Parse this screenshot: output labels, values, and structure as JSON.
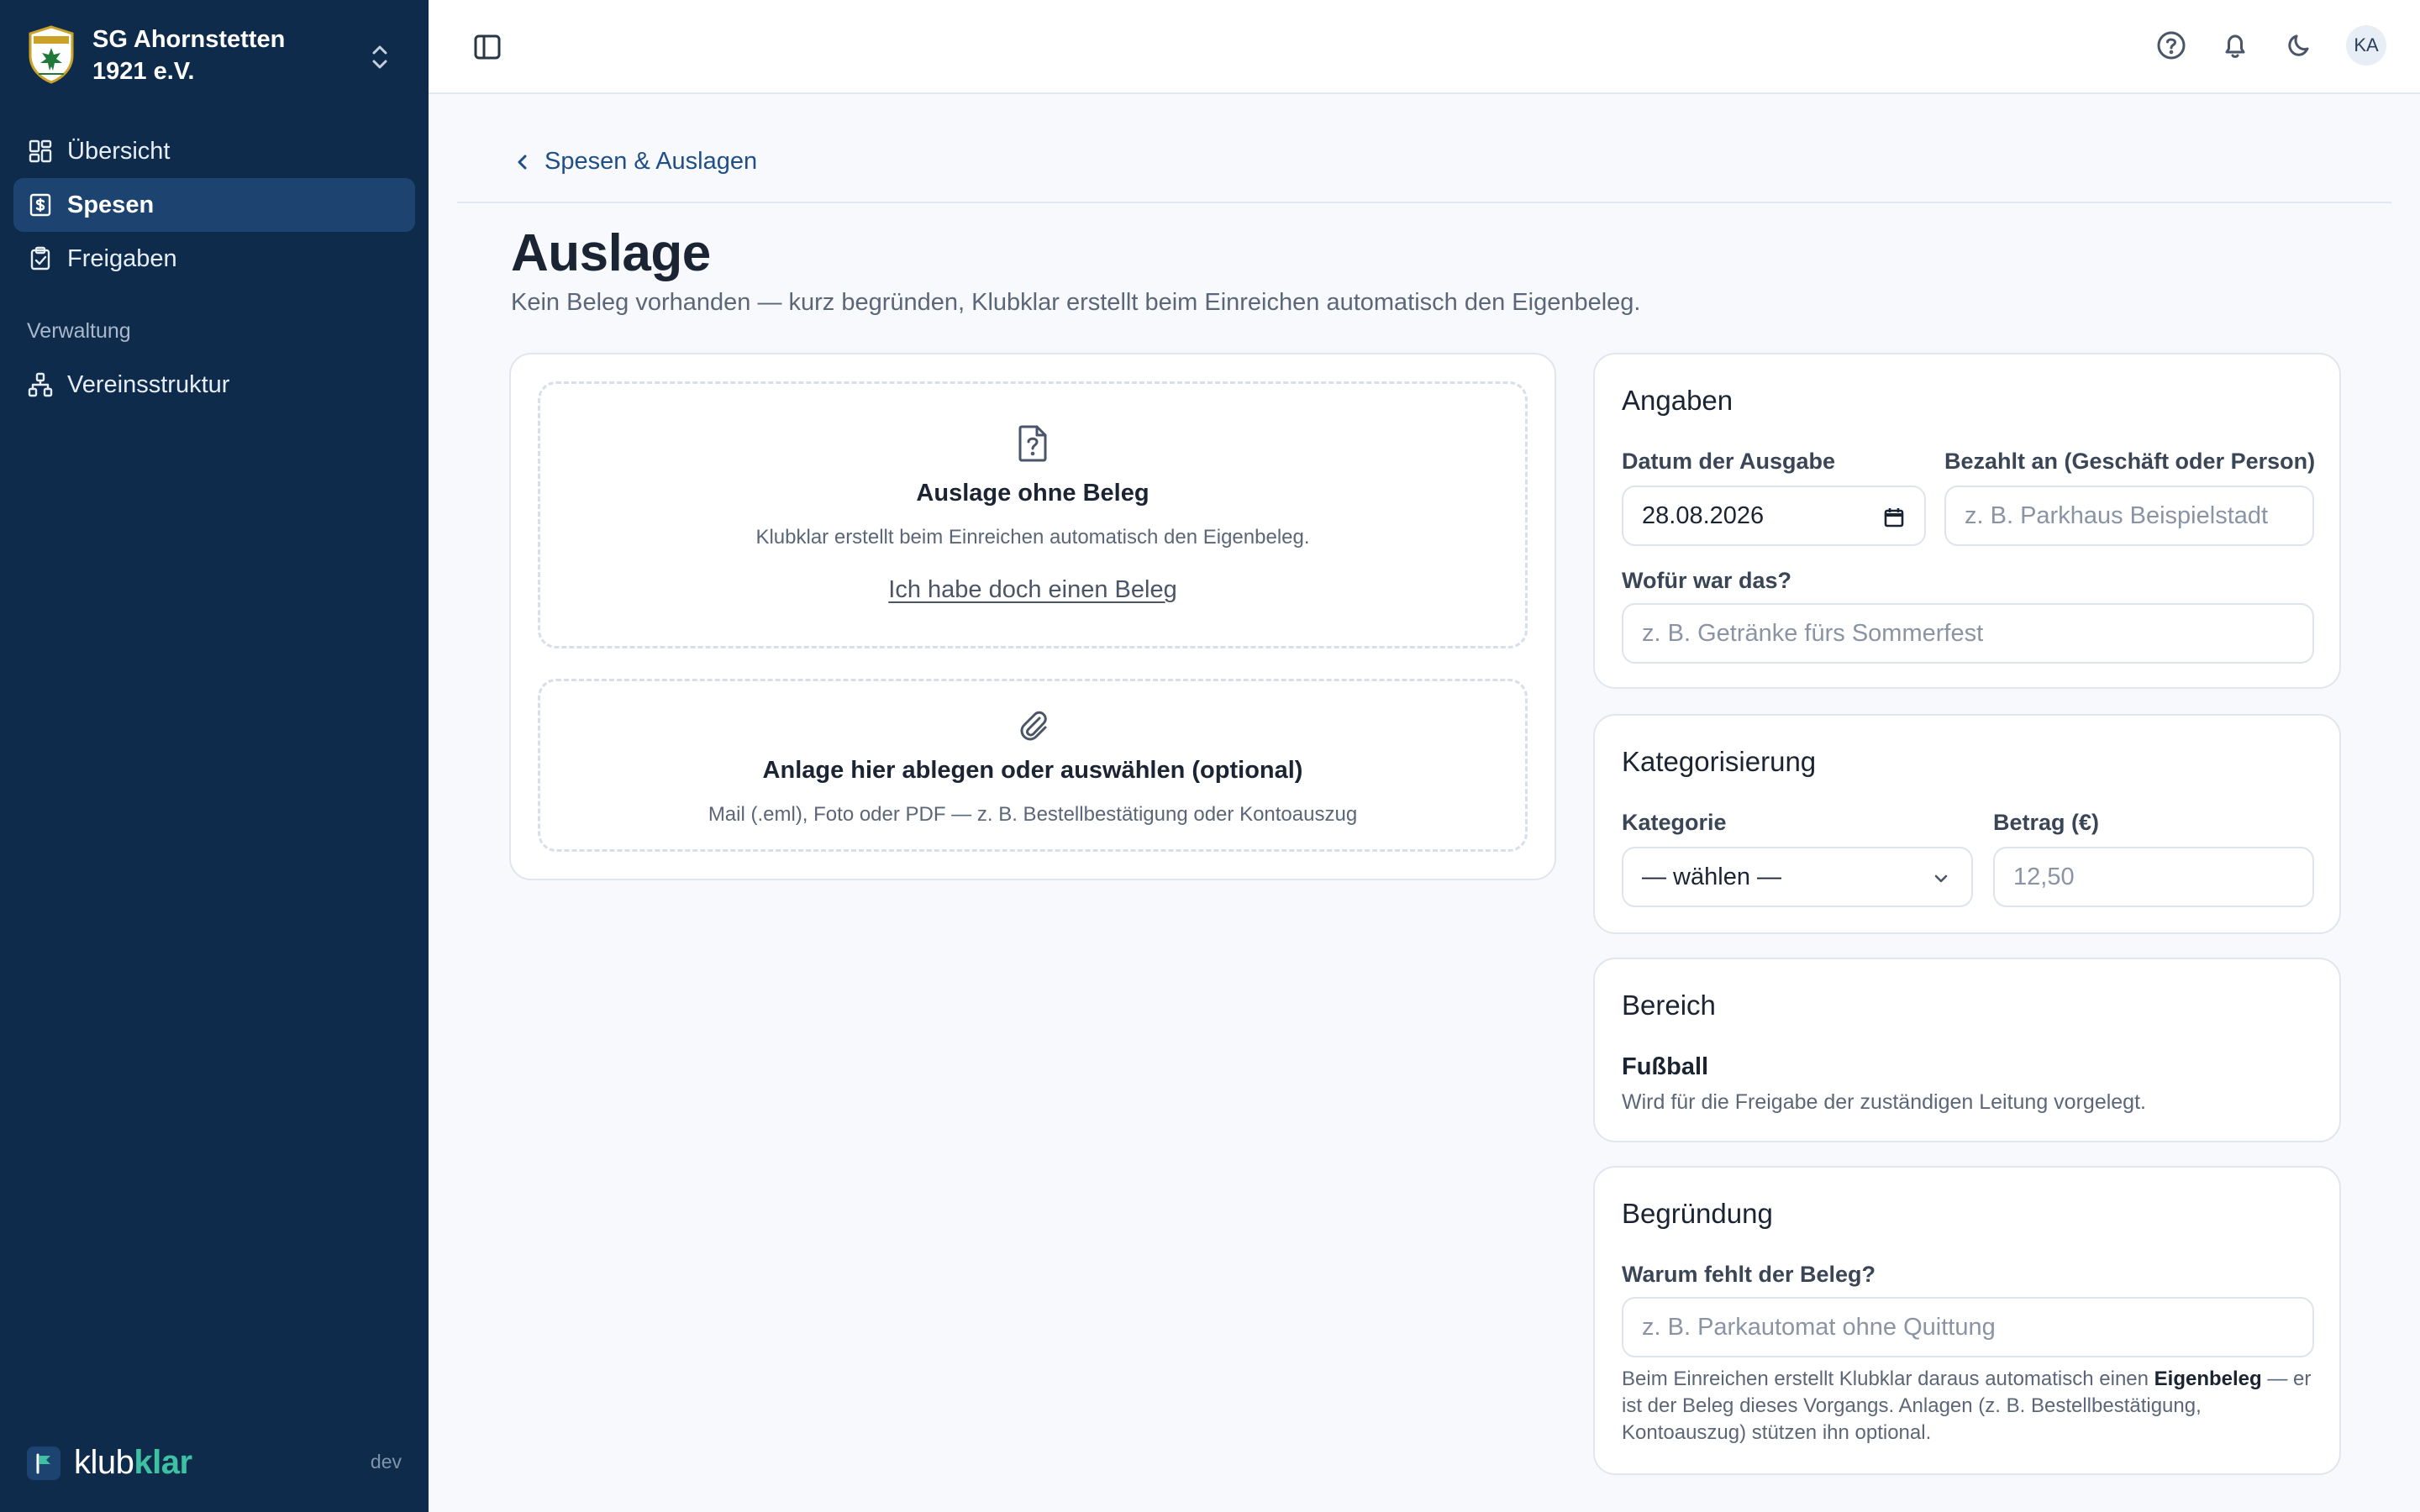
{
  "sidebar": {
    "org_name": "SG Ahornstetten 1921 e.V.",
    "nav": [
      {
        "label": "Übersicht",
        "icon": "dashboard-icon",
        "active": false
      },
      {
        "label": "Spesen",
        "icon": "receipt-icon",
        "active": true
      },
      {
        "label": "Freigaben",
        "icon": "clipboard-check-icon",
        "active": false
      }
    ],
    "section_label": "Verwaltung",
    "admin_nav": [
      {
        "label": "Vereinsstruktur",
        "icon": "org-structure-icon"
      }
    ],
    "brand_klub": "klub",
    "brand_klar": "klar",
    "env": "dev"
  },
  "topbar": {
    "avatar_initials": "KA"
  },
  "page": {
    "back_label": "Spesen & Auslagen",
    "title": "Auslage",
    "subtitle": "Kein Beleg vorhanden — kurz begründen, Klubklar erstellt beim Einreichen automatisch den Eigenbeleg."
  },
  "no_receipt": {
    "title": "Auslage ohne Beleg",
    "text": "Klubklar erstellt beim Einreichen automatisch den Eigenbeleg.",
    "link": "Ich habe doch einen Beleg"
  },
  "attachment": {
    "title": "Anlage hier ablegen oder auswählen (optional)",
    "text": "Mail (.eml), Foto oder PDF — z. B. Bestellbestätigung oder Kontoauszug"
  },
  "angaben": {
    "title": "Angaben",
    "date_label": "Datum der Ausgabe",
    "date_value": "28.08.2026",
    "payee_label": "Bezahlt an (Geschäft oder Person)",
    "payee_placeholder": "z. B. Parkhaus Beispielstadt",
    "purpose_label": "Wofür war das?",
    "purpose_placeholder": "z. B. Getränke fürs Sommerfest"
  },
  "kategorisierung": {
    "title": "Kategorisierung",
    "category_label": "Kategorie",
    "category_value": "— wählen —",
    "amount_label": "Betrag (€)",
    "amount_placeholder": "12,50"
  },
  "bereich": {
    "title": "Bereich",
    "name": "Fußball",
    "text": "Wird für die Freigabe der zuständigen Leitung vorgelegt."
  },
  "begruendung": {
    "title": "Begründung",
    "label": "Warum fehlt der Beleg?",
    "placeholder": "z. B. Parkautomat ohne Quittung",
    "help_1": "Beim Einreichen erstellt Klubklar daraus automatisch einen ",
    "help_bold": "Eigenbeleg",
    "help_2": " — er ist der Beleg dieses Vorgangs. Anlagen (z. B. Bestellbestätigung, Kontoauszug) stützen ihn optional."
  },
  "colors": {
    "sidebar_bg": "#0f2b4c",
    "sidebar_active": "#1d4470",
    "accent_link": "#1f4f86",
    "brand_green": "#3ec1a3"
  }
}
